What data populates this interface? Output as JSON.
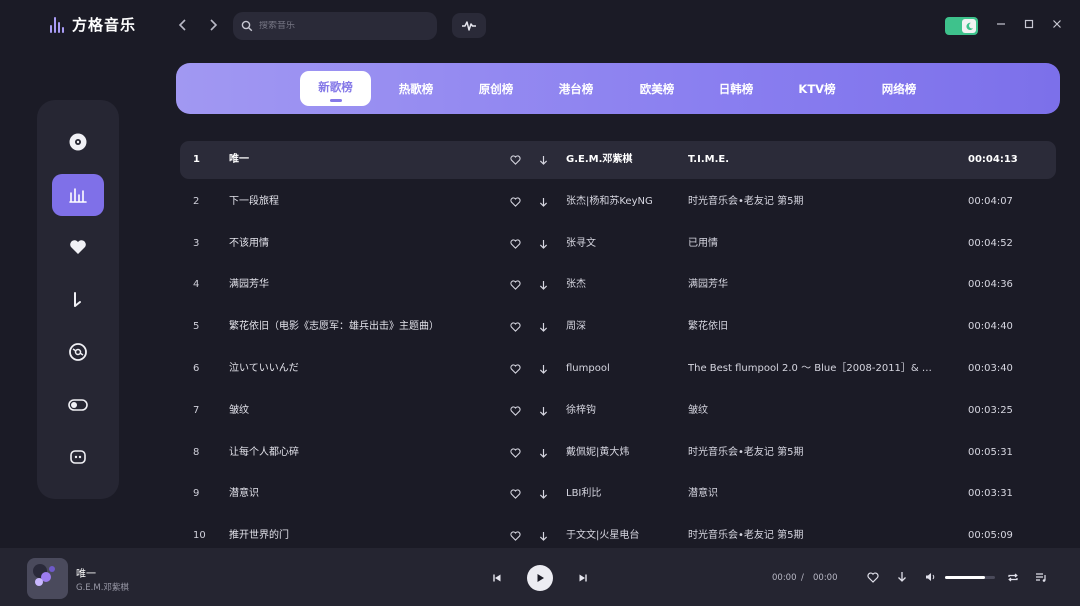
{
  "app": {
    "name": "方格音乐"
  },
  "search": {
    "placeholder": "搜索音乐"
  },
  "tabs": [
    {
      "label": "新歌榜",
      "active": true
    },
    {
      "label": "热歌榜",
      "active": false
    },
    {
      "label": "原创榜",
      "active": false
    },
    {
      "label": "港台榜",
      "active": false
    },
    {
      "label": "欧美榜",
      "active": false
    },
    {
      "label": "日韩榜",
      "active": false
    },
    {
      "label": "KTV榜",
      "active": false
    },
    {
      "label": "网络榜",
      "active": false
    }
  ],
  "songs": [
    {
      "num": "1",
      "title": "唯一",
      "artist": "G.E.M.邓紫棋",
      "album": "T.I.M.E.",
      "duration": "00:04:13"
    },
    {
      "num": "2",
      "title": "下一段旅程",
      "artist": "张杰|杨和苏KeyNG",
      "album": "时光音乐会•老友记 第5期",
      "duration": "00:04:07"
    },
    {
      "num": "3",
      "title": "不该用情",
      "artist": "张寻文",
      "album": "已用情",
      "duration": "00:04:52"
    },
    {
      "num": "4",
      "title": "满园芳华",
      "artist": "张杰",
      "album": "满园芳华",
      "duration": "00:04:36"
    },
    {
      "num": "5",
      "title": "繁花依旧（电影《志愿军：雄兵出击》主题曲）",
      "artist": "周深",
      "album": "繁花依旧",
      "duration": "00:04:40"
    },
    {
      "num": "6",
      "title": "泣いていいんだ",
      "artist": "flumpool",
      "album": "The Best flumpool 2.0 ～ Blue［2008-2011］& …",
      "duration": "00:03:40"
    },
    {
      "num": "7",
      "title": "皱纹",
      "artist": "徐梓钩",
      "album": "皱纹",
      "duration": "00:03:25"
    },
    {
      "num": "8",
      "title": "让每个人都心碎",
      "artist": "戴佩妮|黄大炜",
      "album": "时光音乐会•老友记 第5期",
      "duration": "00:05:31"
    },
    {
      "num": "9",
      "title": "潜意识",
      "artist": "LBI利比",
      "album": "潜意识",
      "duration": "00:03:31"
    },
    {
      "num": "10",
      "title": "推开世界的门",
      "artist": "于文文|火星电台",
      "album": "时光音乐会•老友记 第5期",
      "duration": "00:05:09"
    }
  ],
  "player": {
    "title": "唯一",
    "artist": "G.E.M.邓紫棋",
    "current_time": "00:00",
    "separator": "/",
    "total_time": "00:00",
    "volume": 0.8
  },
  "colors": {
    "accent": "#7f70e8",
    "background": "#1b1b26",
    "toggle": "#3ec28c"
  }
}
